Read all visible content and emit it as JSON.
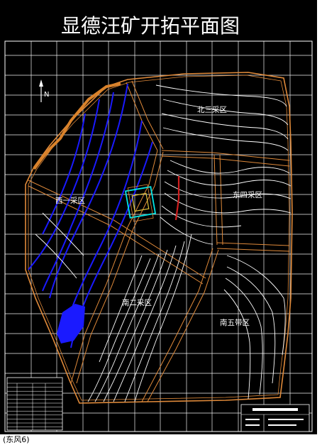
{
  "title": "显德汪矿开拓平面图",
  "north_label": "N",
  "zones": {
    "north3": "北三采区",
    "west": "西一采区",
    "east4": "东四采区",
    "south2": "南二采区",
    "south5": "南五带区"
  },
  "footer": "(东风6)",
  "colors": {
    "background": "#000000",
    "grid": "#ffffff",
    "boundary": "#e08a3a",
    "seam": "#1a1aff",
    "contour": "#ffffff",
    "shaft": "#00e5e5",
    "fault": "#d02020"
  }
}
